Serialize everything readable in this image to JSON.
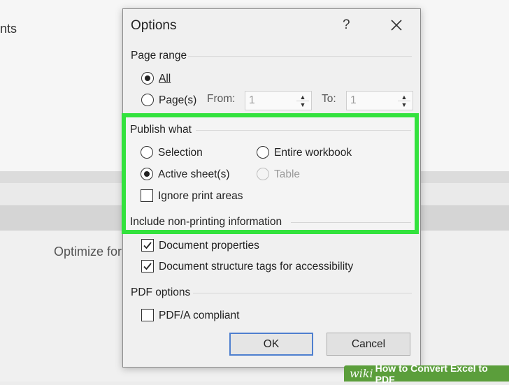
{
  "background": {
    "fragment_nts": "nts",
    "fragment_optimize": "Optimize for"
  },
  "dialog": {
    "title": "Options",
    "help_glyph": "?",
    "page_range": {
      "label": "Page range",
      "all_label": "All",
      "pages_label": "Page(s)",
      "from_label": "From:",
      "from_value": "1",
      "to_label": "To:",
      "to_value": "1"
    },
    "publish_what": {
      "label": "Publish what",
      "selection": "Selection",
      "entire_workbook": "Entire workbook",
      "active_sheets": "Active sheet(s)",
      "table": "Table",
      "ignore_print_areas": "Ignore print areas"
    },
    "non_printing": {
      "label": "Include non-printing information",
      "document_properties": "Document properties",
      "structure_tags": "Document structure tags for accessibility"
    },
    "pdf_options": {
      "label": "PDF options",
      "pdfa": "PDF/A compliant"
    },
    "ok_label": "OK",
    "cancel_label": "Cancel"
  },
  "watermark": {
    "logo": "wiki",
    "text": "How to Convert Excel to PDF"
  },
  "colors": {
    "highlight": "#33e23d",
    "watermark_bg": "#5b9e3b",
    "default_button_border": "#4e7fcf"
  }
}
